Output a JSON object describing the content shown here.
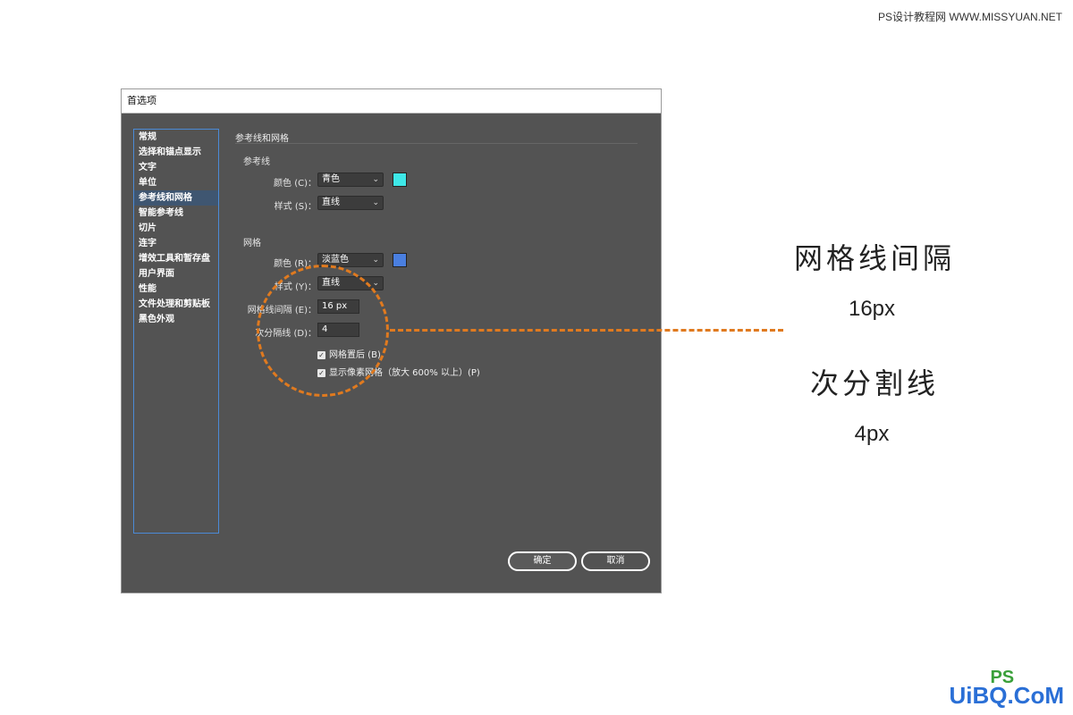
{
  "watermark": "PS设计教程网 WWW.MISSYUAN.NET",
  "dialog": {
    "title": "首选项",
    "sidebar": [
      "常规",
      "选择和锚点显示",
      "文字",
      "单位",
      "参考线和网格",
      "智能参考线",
      "切片",
      "连字",
      "增效工具和暂存盘",
      "用户界面",
      "性能",
      "文件处理和剪贴板",
      "黑色外观"
    ],
    "active_index": 4,
    "section_title": "参考线和网格",
    "guides": {
      "title": "参考线",
      "color_label": "颜色 (C)：",
      "color_value": "青色",
      "color_hex": "#3ee8e8",
      "style_label": "样式 (S)：",
      "style_value": "直线"
    },
    "grid": {
      "title": "网格",
      "color_label": "颜色 (R)：",
      "color_value": "淡蓝色",
      "color_hex": "#4a7fe0",
      "style_label": "样式 (Y)：",
      "style_value": "直线",
      "interval_label": "网格线间隔 (E)：",
      "interval_value": "16 px",
      "subdiv_label": "次分隔线 (D)：",
      "subdiv_value": "4",
      "check_back": "网格置后 (B)",
      "check_pixel": "显示像素网格（放大 600% 以上）(P)"
    },
    "ok": "确定",
    "cancel": "取消"
  },
  "annotations": {
    "grid_interval_title": "网格线间隔",
    "grid_interval_value": "16px",
    "subdiv_title": "次分割线",
    "subdiv_value": "4px"
  },
  "logo": {
    "text": "UiBQ.CoM",
    "ps": "PS"
  }
}
